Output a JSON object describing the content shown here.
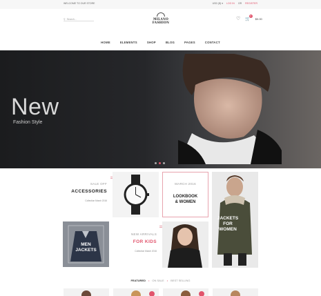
{
  "topbar": {
    "welcome": "WELCOME TO OUR STORE",
    "currency": "USD ($) ▾",
    "login": "LOG IN",
    "or": "OR",
    "register": "REGISTER"
  },
  "header": {
    "search_placeholder": "Search...",
    "logo_line1": "MILANO",
    "logo_line2": "FASHION",
    "cart_count": "0",
    "cart_total": "$0.00"
  },
  "nav": [
    "HOME",
    "ELEMENTS",
    "SHOP",
    "BLOG",
    "PAGES",
    "CONTACT"
  ],
  "hero": {
    "title": "New",
    "subtitle": "Fashion Style"
  },
  "promo": {
    "accessories": {
      "small": "SALE OFF",
      "title": "ACCESSORIES",
      "tiny": "Collection March 2016"
    },
    "lookbook": {
      "date": "MARCH 2016",
      "title1": "LOOKBOOK",
      "title2": "& WOMEN"
    },
    "jackets_women": {
      "title1": "JACKETS",
      "title2": "FOR",
      "title3": "WOMEN"
    },
    "men_jackets": {
      "title1": "MEN",
      "title2": "JACKETS"
    },
    "kids": {
      "small": "NEW ARRIVALS",
      "title": "FOR KIDS",
      "tiny": "Collection March 2016"
    }
  },
  "tabs": {
    "featured": "FEATURED",
    "onsale": "ON SALE",
    "bestselling": "BEST SELLING"
  },
  "colors": {
    "accent": "#e1546c"
  }
}
